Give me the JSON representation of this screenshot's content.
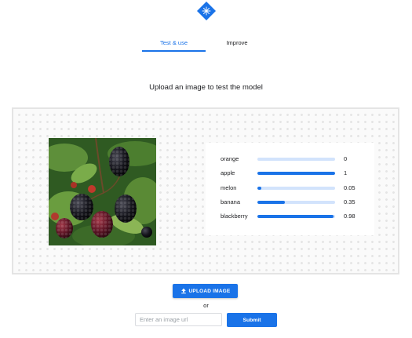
{
  "header": {
    "logo_icon": "sparkle-logo-icon"
  },
  "tabs": [
    {
      "label": "Test & use",
      "active": true
    },
    {
      "label": "Improve",
      "active": false
    }
  ],
  "main": {
    "heading": "Upload an image to test the model",
    "image_alt": "blackberries on bush",
    "predictions": [
      {
        "label": "orange",
        "score": 0,
        "score_text": "0"
      },
      {
        "label": "apple",
        "score": 1,
        "score_text": "1"
      },
      {
        "label": "melon",
        "score": 0.05,
        "score_text": "0.05"
      },
      {
        "label": "banana",
        "score": 0.35,
        "score_text": "0.35"
      },
      {
        "label": "blackberry",
        "score": 0.98,
        "score_text": "0.98"
      }
    ]
  },
  "upload": {
    "button_label": "UPLOAD IMAGE",
    "button_icon": "upload-icon",
    "or_text": "or",
    "url_placeholder": "Enter an image url",
    "url_value": "",
    "submit_label": "Submit"
  },
  "colors": {
    "accent": "#1a73e8",
    "track": "#d2e3fc"
  }
}
